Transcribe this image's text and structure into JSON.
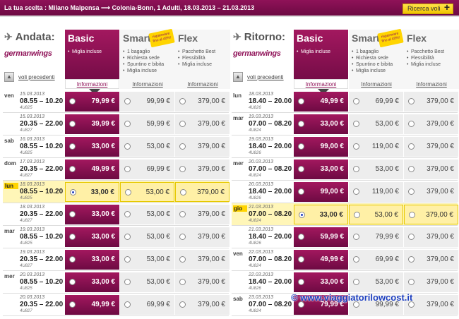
{
  "summary": "La tua scelta : Milano Malpensa ⟶ Colonia-Bonn, 1 Adulti, 18.03.2013 – 21.03.2013",
  "search_button": "Ricerca voli",
  "outbound": {
    "title": "Andata:",
    "airline": "germanwings",
    "prev": "voli precedenti",
    "fares": {
      "basic": {
        "name": "Basic",
        "features": [
          "Miglia incluse"
        ],
        "info": "Informazioni"
      },
      "smart": {
        "name": "Smart",
        "badge": "risparmiare fino al 40%!",
        "features": [
          "1 bagaglio",
          "Richiesta sede",
          "Spuntino e bibita",
          "Miglia incluse"
        ],
        "info": "Informazioni"
      },
      "flex": {
        "name": "Flex",
        "features": [
          "Pacchetto Best",
          "Flessibilità",
          "Miglia incluse"
        ],
        "info": "Informazioni"
      }
    },
    "rows": [
      {
        "day": "ven",
        "date": "15.03.2013",
        "time": "08.55 – 10.20",
        "flight": "4U825",
        "basic": "79,99 €",
        "smart": "99,99 €",
        "flex": "379,00 €",
        "selected": false
      },
      {
        "day": "",
        "date": "15.03.2013",
        "time": "20.35 – 22.00",
        "flight": "4U827",
        "basic": "39,99 €",
        "smart": "59,99 €",
        "flex": "379,00 €",
        "selected": false
      },
      {
        "day": "sab",
        "date": "16.03.2013",
        "time": "08.55 – 10.20",
        "flight": "4U825",
        "basic": "33,00 €",
        "smart": "53,00 €",
        "flex": "379,00 €",
        "selected": false
      },
      {
        "day": "dom",
        "date": "17.03.2013",
        "time": "20.35 – 22.00",
        "flight": "4U827",
        "basic": "49,99 €",
        "smart": "69,99 €",
        "flex": "379,00 €",
        "selected": false
      },
      {
        "day": "lun",
        "date": "18.03.2013",
        "time": "08.55 – 10.20",
        "flight": "4U825",
        "basic": "33,00 €",
        "smart": "53,00 €",
        "flex": "379,00 €",
        "selected": true
      },
      {
        "day": "",
        "date": "18.03.2013",
        "time": "20.35 – 22.00",
        "flight": "4U827",
        "basic": "33,00 €",
        "smart": "53,00 €",
        "flex": "379,00 €",
        "selected": false
      },
      {
        "day": "mar",
        "date": "19.03.2013",
        "time": "08.55 – 10.20",
        "flight": "4U825",
        "basic": "33,00 €",
        "smart": "53,00 €",
        "flex": "379,00 €",
        "selected": false
      },
      {
        "day": "",
        "date": "19.03.2013",
        "time": "20.35 – 22.00",
        "flight": "4U827",
        "basic": "33,00 €",
        "smart": "53,00 €",
        "flex": "379,00 €",
        "selected": false
      },
      {
        "day": "mer",
        "date": "20.03.2013",
        "time": "08.55 – 10.20",
        "flight": "4U825",
        "basic": "33,00 €",
        "smart": "53,00 €",
        "flex": "379,00 €",
        "selected": false
      },
      {
        "day": "",
        "date": "20.03.2013",
        "time": "20.35 – 22.00",
        "flight": "4U827",
        "basic": "49,99 €",
        "smart": "69,99 €",
        "flex": "379,00 €",
        "selected": false
      }
    ]
  },
  "return": {
    "title": "Ritorno:",
    "airline": "germanwings",
    "prev": "voli precedenti",
    "fares": {
      "basic": {
        "name": "Basic",
        "features": [
          "Miglia incluse"
        ],
        "info": "Informazioni"
      },
      "smart": {
        "name": "Smart",
        "badge": "risparmiare fino al 40%!",
        "features": [
          "1 bagaglio",
          "Richiesta sede",
          "Spuntino e bibita",
          "Miglia incluse"
        ],
        "info": "Informazioni"
      },
      "flex": {
        "name": "Flex",
        "features": [
          "Pacchetto Best",
          "Flessibilità",
          "Miglia incluse"
        ],
        "info": "Informazioni"
      }
    },
    "rows": [
      {
        "day": "lun",
        "date": "18.03.2013",
        "time": "18.40 – 20.00",
        "flight": "4U826",
        "basic": "49,99 €",
        "smart": "69,99 €",
        "flex": "379,00 €",
        "selected": false
      },
      {
        "day": "mar",
        "date": "19.03.2013",
        "time": "07.00 – 08.20",
        "flight": "4U824",
        "basic": "33,00 €",
        "smart": "53,00 €",
        "flex": "379,00 €",
        "selected": false
      },
      {
        "day": "",
        "date": "19.03.2013",
        "time": "18.40 – 20.00",
        "flight": "4U826",
        "basic": "99,00 €",
        "smart": "119,00 €",
        "flex": "379,00 €",
        "selected": false
      },
      {
        "day": "mer",
        "date": "20.03.2013",
        "time": "07.00 – 08.20",
        "flight": "4U824",
        "basic": "33,00 €",
        "smart": "53,00 €",
        "flex": "379,00 €",
        "selected": false
      },
      {
        "day": "",
        "date": "20.03.2013",
        "time": "18.40 – 20.00",
        "flight": "4U826",
        "basic": "99,00 €",
        "smart": "119,00 €",
        "flex": "379,00 €",
        "selected": false
      },
      {
        "day": "gio",
        "date": "21.03.2013",
        "time": "07.00 – 08.20",
        "flight": "4U824",
        "basic": "33,00 €",
        "smart": "53,00 €",
        "flex": "379,00 €",
        "selected": true
      },
      {
        "day": "",
        "date": "21.03.2013",
        "time": "18.40 – 20.00",
        "flight": "4U826",
        "basic": "59,99 €",
        "smart": "79,99 €",
        "flex": "379,00 €",
        "selected": false
      },
      {
        "day": "ven",
        "date": "22.03.2013",
        "time": "07.00 – 08.20",
        "flight": "4U824",
        "basic": "49,99 €",
        "smart": "69,99 €",
        "flex": "379,00 €",
        "selected": false
      },
      {
        "day": "",
        "date": "22.03.2013",
        "time": "18.40 – 20.00",
        "flight": "4U826",
        "basic": "33,00 €",
        "smart": "53,00 €",
        "flex": "379,00 €",
        "selected": false
      },
      {
        "day": "sab",
        "date": "23.03.2013",
        "time": "07.00 – 08.20",
        "flight": "4U824",
        "basic": "79,99 €",
        "smart": "99,99 €",
        "flex": "379,00 €",
        "selected": false
      }
    ]
  },
  "watermark": "© www.viaggiatorilowcost.it"
}
